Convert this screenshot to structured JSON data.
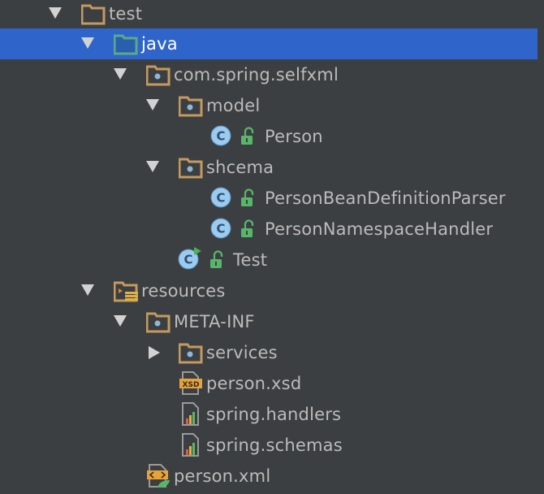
{
  "tree": {
    "nodes": [
      {
        "label": "test",
        "icon": "folder-icon",
        "expanded": true
      },
      {
        "label": "java",
        "icon": "source-folder-icon",
        "expanded": true,
        "selected": true
      },
      {
        "label": "com.spring.selfxml",
        "icon": "package-icon",
        "expanded": true
      },
      {
        "label": "model",
        "icon": "package-icon",
        "expanded": true
      },
      {
        "label": "Person",
        "icon": "class-icon"
      },
      {
        "label": "shcema",
        "icon": "package-icon",
        "expanded": true
      },
      {
        "label": "PersonBeanDefinitionParser",
        "icon": "class-icon"
      },
      {
        "label": "PersonNamespaceHandler",
        "icon": "class-icon"
      },
      {
        "label": "Test",
        "icon": "runnable-class-icon"
      },
      {
        "label": "resources",
        "icon": "resources-folder-icon",
        "expanded": true
      },
      {
        "label": "META-INF",
        "icon": "package-icon",
        "expanded": true
      },
      {
        "label": "services",
        "icon": "package-icon",
        "expanded": false
      },
      {
        "label": "person.xsd",
        "icon": "xsd-file-icon",
        "badge": "XSD"
      },
      {
        "label": "spring.handlers",
        "icon": "properties-file-icon"
      },
      {
        "label": "spring.schemas",
        "icon": "properties-file-icon"
      },
      {
        "label": "person.xml",
        "icon": "xml-file-icon"
      }
    ]
  },
  "colors": {
    "background": "#3c3f41",
    "selection": "#2f65ca",
    "text": "#bbbbbb",
    "folder": "#c59a5e",
    "source_folder": "#5aaa8a",
    "class_circle": "#9ccbf0",
    "lock": "#58b66a"
  }
}
